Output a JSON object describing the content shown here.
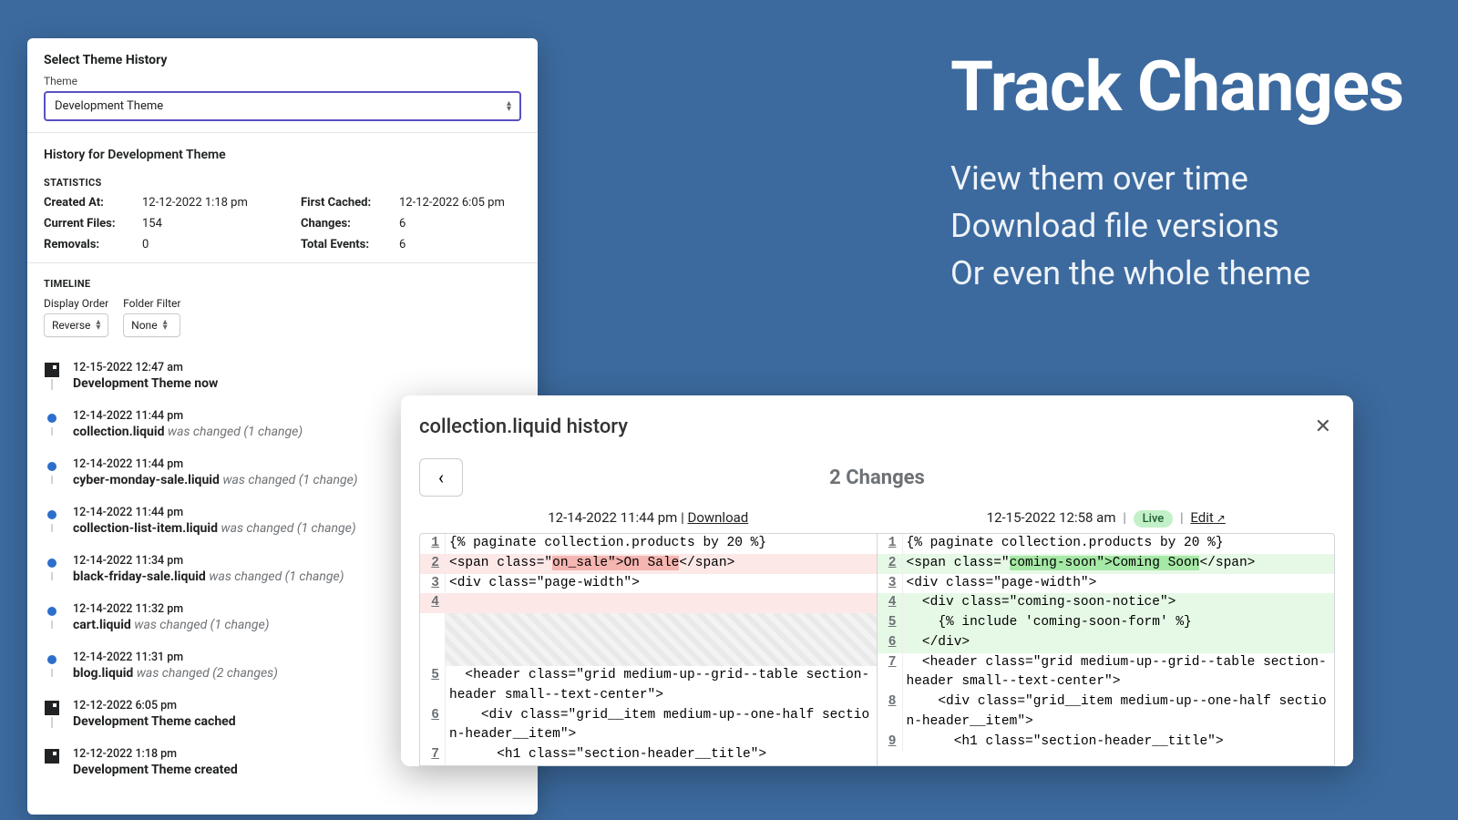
{
  "hero": {
    "title": "Track Changes",
    "line1": "View them over time",
    "line2": "Download file versions",
    "line3": "Or even the whole theme"
  },
  "left": {
    "selectTitle": "Select Theme History",
    "themeLabel": "Theme",
    "themeValue": "Development Theme",
    "historyFor": "History for Development Theme",
    "statsHeading": "STATISTICS",
    "stats": {
      "createdAtLabel": "Created At:",
      "createdAt": "12-12-2022 1:18 pm",
      "firstCachedLabel": "First Cached:",
      "firstCached": "12-12-2022 6:05 pm",
      "currentFilesLabel": "Current Files:",
      "currentFiles": "154",
      "changesLabel": "Changes:",
      "changes": "6",
      "removalsLabel": "Removals:",
      "removals": "0",
      "totalEventsLabel": "Total Events:",
      "totalEvents": "6"
    },
    "timelineHeading": "TIMELINE",
    "displayOrderLabel": "Display Order",
    "displayOrderValue": "Reverse",
    "folderFilterLabel": "Folder Filter",
    "folderFilterValue": "None",
    "items": [
      {
        "kind": "square",
        "time": "12-15-2022 12:47 am",
        "main": "Development Theme now",
        "action": ""
      },
      {
        "kind": "dot",
        "time": "12-14-2022 11:44 pm",
        "main": "collection.liquid",
        "action": "was changed (1 change)"
      },
      {
        "kind": "dot",
        "time": "12-14-2022 11:44 pm",
        "main": "cyber-monday-sale.liquid",
        "action": "was changed (1 change)"
      },
      {
        "kind": "dot",
        "time": "12-14-2022 11:44 pm",
        "main": "collection-list-item.liquid",
        "action": "was changed (1 change)"
      },
      {
        "kind": "dot",
        "time": "12-14-2022 11:34 pm",
        "main": "black-friday-sale.liquid",
        "action": "was changed (1 change)"
      },
      {
        "kind": "dot",
        "time": "12-14-2022 11:32 pm",
        "main": "cart.liquid",
        "action": "was changed (1 change)"
      },
      {
        "kind": "dot",
        "time": "12-14-2022 11:31 pm",
        "main": "blog.liquid",
        "action": "was changed (2 changes)"
      },
      {
        "kind": "square",
        "time": "12-12-2022 6:05 pm",
        "main": "Development Theme cached",
        "action": ""
      },
      {
        "kind": "square",
        "time": "12-12-2022 1:18 pm",
        "main": "Development Theme created",
        "action": ""
      }
    ]
  },
  "diff": {
    "title": "collection.liquid history",
    "changesHeading": "2 Changes",
    "leftMeta": {
      "time": "12-14-2022 11:44 pm",
      "download": "Download"
    },
    "rightMeta": {
      "time": "12-15-2022 12:58 am",
      "liveBadge": "Live",
      "edit": "Edit"
    },
    "left": [
      {
        "n": "1",
        "t": "{% paginate collection.products by 20 %}",
        "cls": ""
      },
      {
        "n": "2",
        "pre": "<span class=\"",
        "hl": "on_sale\">On Sale",
        "post": "</span>",
        "cls": "bg-red",
        "hlcls": "bg-red-dark"
      },
      {
        "n": "3",
        "t": "<div class=\"page-width\">",
        "cls": ""
      },
      {
        "n": "4",
        "t": "",
        "cls": "bg-red hatchpad"
      },
      {
        "n": "5",
        "t": "  <header class=\"grid medium-up--grid--table section-header small--text-center\">",
        "cls": ""
      },
      {
        "n": "6",
        "t": "    <div class=\"grid__item medium-up--one-half section-header__item\">",
        "cls": ""
      },
      {
        "n": "7",
        "t": "      <h1 class=\"section-header__title\">",
        "cls": ""
      }
    ],
    "right": [
      {
        "n": "1",
        "t": "{% paginate collection.products by 20 %}",
        "cls": ""
      },
      {
        "n": "2",
        "pre": "<span class=\"",
        "hl": "coming-soon\">Coming Soon",
        "post": "</span>",
        "cls": "bg-green",
        "hlcls": "bg-green-dark"
      },
      {
        "n": "3",
        "t": "<div class=\"page-width\">",
        "cls": ""
      },
      {
        "n": "4",
        "t": "  <div class=\"coming-soon-notice\">",
        "cls": "bg-green"
      },
      {
        "n": "5",
        "t": "    {% include 'coming-soon-form' %}",
        "cls": "bg-green"
      },
      {
        "n": "6",
        "t": "  </div>",
        "cls": "bg-green"
      },
      {
        "n": "7",
        "t": "  <header class=\"grid medium-up--grid--table section-header small--text-center\">",
        "cls": ""
      },
      {
        "n": "8",
        "t": "    <div class=\"grid__item medium-up--one-half section-header__item\">",
        "cls": ""
      },
      {
        "n": "9",
        "t": "      <h1 class=\"section-header__title\">",
        "cls": ""
      }
    ]
  }
}
